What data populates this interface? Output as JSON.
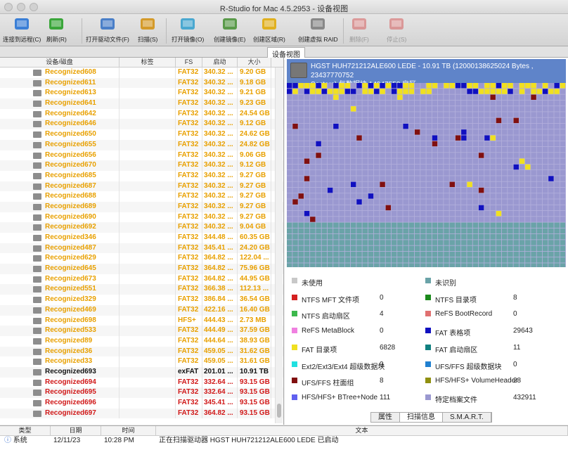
{
  "window": {
    "title": "R-Studio for Mac 4.5.2953 - 设备视图"
  },
  "toolbar": [
    {
      "label": "连接到远程(C)",
      "icon": "remote-connect-icon",
      "enabled": true
    },
    {
      "label": "刷新(R)",
      "icon": "refresh-icon",
      "enabled": true
    },
    {
      "label": "打开驱动文件(F)",
      "icon": "open-drive-file-icon",
      "enabled": true
    },
    {
      "label": "扫描(S)",
      "icon": "scan-icon",
      "enabled": true
    },
    {
      "label": "打开镜像(O)",
      "icon": "open-image-icon",
      "enabled": true
    },
    {
      "label": "创建镜像(E)",
      "icon": "create-image-icon",
      "enabled": true
    },
    {
      "label": "创建区域(R)",
      "icon": "create-region-icon",
      "enabled": true
    },
    {
      "label": "创建虚拟 RAID",
      "icon": "create-virtual-raid-icon",
      "enabled": true
    },
    {
      "label": "删除(F)",
      "icon": "delete-icon",
      "enabled": false
    },
    {
      "label": "停止(S)",
      "icon": "stop-icon",
      "enabled": false
    }
  ],
  "tab": {
    "label": "设备视图"
  },
  "columns": [
    "设备/磁盘",
    "标签",
    "FS",
    "启动",
    "大小"
  ],
  "rows": [
    {
      "name": "Recognized608",
      "fs": "FAT32",
      "start": "340.32 ...",
      "size": "9.20 GB",
      "color": "#e8a000"
    },
    {
      "name": "Recognized611",
      "fs": "FAT32",
      "start": "340.32 ...",
      "size": "9.18 GB",
      "color": "#e8a000"
    },
    {
      "name": "Recognized613",
      "fs": "FAT32",
      "start": "340.32 ...",
      "size": "9.21 GB",
      "color": "#e8a000"
    },
    {
      "name": "Recognized641",
      "fs": "FAT32",
      "start": "340.32 ...",
      "size": "9.23 GB",
      "color": "#e8a000"
    },
    {
      "name": "Recognized642",
      "fs": "FAT32",
      "start": "340.32 ...",
      "size": "24.54 GB",
      "color": "#e8a000"
    },
    {
      "name": "Recognized646",
      "fs": "FAT32",
      "start": "340.32 ...",
      "size": "9.12 GB",
      "color": "#e8a000"
    },
    {
      "name": "Recognized650",
      "fs": "FAT32",
      "start": "340.32 ...",
      "size": "24.62 GB",
      "color": "#e8a000"
    },
    {
      "name": "Recognized655",
      "fs": "FAT32",
      "start": "340.32 ...",
      "size": "24.82 GB",
      "color": "#e8a000"
    },
    {
      "name": "Recognized656",
      "fs": "FAT32",
      "start": "340.32 ...",
      "size": "9.06 GB",
      "color": "#e8a000"
    },
    {
      "name": "Recognized670",
      "fs": "FAT32",
      "start": "340.32 ...",
      "size": "9.12 GB",
      "color": "#e8a000"
    },
    {
      "name": "Recognized685",
      "fs": "FAT32",
      "start": "340.32 ...",
      "size": "9.27 GB",
      "color": "#e8a000"
    },
    {
      "name": "Recognized687",
      "fs": "FAT32",
      "start": "340.32 ...",
      "size": "9.27 GB",
      "color": "#e8a000"
    },
    {
      "name": "Recognized688",
      "fs": "FAT32",
      "start": "340.32 ...",
      "size": "9.27 GB",
      "color": "#e8a000"
    },
    {
      "name": "Recognized689",
      "fs": "FAT32",
      "start": "340.32 ...",
      "size": "9.27 GB",
      "color": "#e8a000"
    },
    {
      "name": "Recognized690",
      "fs": "FAT32",
      "start": "340.32 ...",
      "size": "9.27 GB",
      "color": "#e8a000"
    },
    {
      "name": "Recognized692",
      "fs": "FAT32",
      "start": "340.32 ...",
      "size": "9.04 GB",
      "color": "#e8a000"
    },
    {
      "name": "Recognized346",
      "fs": "FAT32",
      "start": "344.48 ...",
      "size": "60.35 GB",
      "color": "#e8a000"
    },
    {
      "name": "Recognized487",
      "fs": "FAT32",
      "start": "345.41 ...",
      "size": "24.20 GB",
      "color": "#e8a000"
    },
    {
      "name": "Recognized629",
      "fs": "FAT32",
      "start": "364.82 ...",
      "size": "122.04 ...",
      "color": "#e8a000"
    },
    {
      "name": "Recognized645",
      "fs": "FAT32",
      "start": "364.82 ...",
      "size": "75.96 GB",
      "color": "#e8a000"
    },
    {
      "name": "Recognized673",
      "fs": "FAT32",
      "start": "364.82 ...",
      "size": "44.95 GB",
      "color": "#e8a000"
    },
    {
      "name": "Recognized551",
      "fs": "FAT32",
      "start": "366.38 ...",
      "size": "112.13 ...",
      "color": "#e8a000"
    },
    {
      "name": "Recognized329",
      "fs": "FAT32",
      "start": "386.84 ...",
      "size": "36.54 GB",
      "color": "#e8a000"
    },
    {
      "name": "Recognized469",
      "fs": "FAT32",
      "start": "422.16 ...",
      "size": "16.40 GB",
      "color": "#e8a000"
    },
    {
      "name": "Recognized698",
      "fs": "HFS+",
      "start": "444.43 ...",
      "size": "2.73 MB",
      "color": "#e8a000"
    },
    {
      "name": "Recognized533",
      "fs": "FAT32",
      "start": "444.49 ...",
      "size": "37.59 GB",
      "color": "#e8a000"
    },
    {
      "name": "Recognized89",
      "fs": "FAT32",
      "start": "444.64 ...",
      "size": "38.93 GB",
      "color": "#e8a000"
    },
    {
      "name": "Recognized36",
      "fs": "FAT32",
      "start": "459.05 ...",
      "size": "31.62 GB",
      "color": "#e8a000"
    },
    {
      "name": "Recognized33",
      "fs": "FAT32",
      "start": "459.05 ...",
      "size": "31.61 GB",
      "color": "#e8a000"
    },
    {
      "name": "Recognized693",
      "fs": "exFAT",
      "start": "201.01 ...",
      "size": "10.91 TB",
      "color": "#111111"
    },
    {
      "name": "Recognized694",
      "fs": "FAT32",
      "start": "332.64 ...",
      "size": "93.15 GB",
      "color": "#d01818"
    },
    {
      "name": "Recognized695",
      "fs": "FAT32",
      "start": "332.64 ...",
      "size": "93.15 GB",
      "color": "#d01818"
    },
    {
      "name": "Recognized696",
      "fs": "FAT32",
      "start": "345.41 ...",
      "size": "93.15 GB",
      "color": "#d01818"
    },
    {
      "name": "Recognized697",
      "fs": "FAT32",
      "start": "364.82 ...",
      "size": "93.15 GB",
      "color": "#d01818"
    }
  ],
  "disk": {
    "line1": "HGST HUH721212ALE600 LEDE - 10.91 TB (12000138625024 Bytes , 23437770752",
    "line2": "Sectors) 每数据块 14947558 扇区"
  },
  "legend": [
    {
      "label": "未使用",
      "value": "",
      "color": "#c8c8c8"
    },
    {
      "label": "未识别",
      "value": "",
      "color": "#6aa3a8"
    },
    {
      "label": "NTFS MFT 文件项",
      "value": "0",
      "color": "#d42020"
    },
    {
      "label": "NTFS 目录项",
      "value": "8",
      "color": "#1c8a1c"
    },
    {
      "label": "NTFS 启动扇区",
      "value": "4",
      "color": "#3cb84c"
    },
    {
      "label": "ReFS BootRecord",
      "value": "0",
      "color": "#e07070"
    },
    {
      "label": "ReFS MetaBlock",
      "value": "0",
      "color": "#f080e0"
    },
    {
      "label": "FAT 表格项",
      "value": "29643",
      "color": "#1010c0"
    },
    {
      "label": "FAT 目录项",
      "value": "6828",
      "color": "#f0e020"
    },
    {
      "label": "FAT 启动扇区",
      "value": "11",
      "color": "#108080"
    },
    {
      "label": "Ext2/Ext3/Ext4 超级数据块",
      "value": "0",
      "color": "#20e0e0"
    },
    {
      "label": "UFS/FFS 超级数据块",
      "value": "0",
      "color": "#2080d0"
    },
    {
      "label": "UFS/FFS 柱面组",
      "value": "8",
      "color": "#801010"
    },
    {
      "label": "HFS/HFS+ VolumeHeader",
      "value": "28",
      "color": "#909010"
    },
    {
      "label": "HFS/HFS+ BTree+Node",
      "value": "111",
      "color": "#6060f0"
    },
    {
      "label": "特定档案文件",
      "value": "432911",
      "color": "#9a98d0"
    }
  ],
  "bottom_tabs": [
    "属性",
    "扫描信息",
    "S.M.A.R.T."
  ],
  "log": {
    "columns": [
      "类型",
      "日期",
      "时间",
      "文本"
    ],
    "row": {
      "type": "系统",
      "date": "12/11/23",
      "time": "10:28 PM",
      "text": "正在扫描驱动器 HGST HUH721212ALE600 LEDE 已启动"
    }
  }
}
